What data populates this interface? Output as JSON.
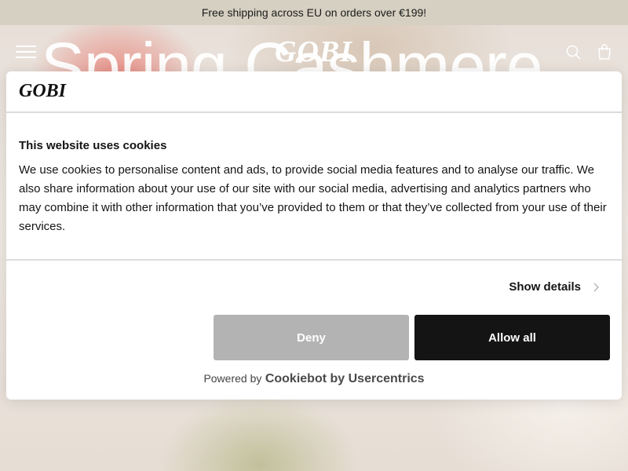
{
  "announcement": {
    "text": "Free shipping across EU on orders over €199!"
  },
  "hero": {
    "title": "Spring Cashmere"
  },
  "header": {
    "logo": "GOBI",
    "menu_icon": "hamburger-menu-icon",
    "search_icon": "search-icon",
    "bag_icon": "shopping-bag-icon"
  },
  "cookie_modal": {
    "logo": "GOBI",
    "heading": "This website uses cookies",
    "body": "We use cookies to personalise content and ads, to provide social media features and to analyse our traffic. We also share information about your use of our site with our social media, advertising and analytics partners who may combine it with other information that you’ve provided to them or that they’ve collected from your use of their services.",
    "show_details_label": "Show details",
    "deny_label": "Deny",
    "allow_all_label": "Allow all",
    "powered_by": "Powered by",
    "provider": "Cookiebot by Usercentrics"
  },
  "colors": {
    "announcement_bg": "#d6d0c2",
    "deny_bg": "#b3b3b3",
    "allow_bg": "#141414"
  }
}
